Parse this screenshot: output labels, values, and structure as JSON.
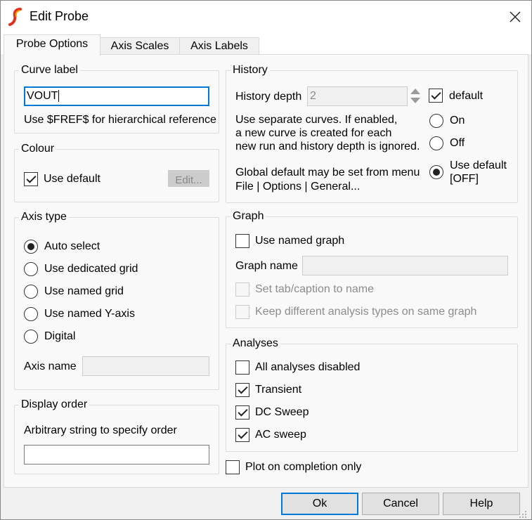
{
  "window": {
    "title": "Edit Probe",
    "close_icon": "close-icon",
    "app_icon": "simetrix-logo-icon"
  },
  "tabs": [
    {
      "label": "Probe Options",
      "active": true
    },
    {
      "label": "Axis Scales",
      "active": false
    },
    {
      "label": "Axis Labels",
      "active": false
    }
  ],
  "curve_label": {
    "group": "Curve label",
    "value": "VOUT",
    "hint": "Use $FREF$ for hierarchical reference"
  },
  "colour": {
    "group": "Colour",
    "use_default": "Use default",
    "use_default_checked": true,
    "edit_button": "Edit..."
  },
  "axis_type": {
    "group": "Axis type",
    "options": [
      {
        "label": "Auto select",
        "checked": true
      },
      {
        "label": "Use dedicated grid",
        "checked": false
      },
      {
        "label": "Use named grid",
        "checked": false
      },
      {
        "label": "Use named Y-axis",
        "checked": false
      },
      {
        "label": "Digital",
        "checked": false
      }
    ],
    "axis_name_label": "Axis name",
    "axis_name_value": ""
  },
  "display_order": {
    "group": "Display order",
    "hint": "Arbitrary string to specify order",
    "value": ""
  },
  "history": {
    "group": "History",
    "depth_label": "History depth",
    "depth_value": "2",
    "default_label": "default",
    "default_checked": true,
    "separate_text_1": "Use separate curves. If enabled,",
    "separate_text_2": "a new curve is created for each",
    "separate_text_3": "new run and history depth is ignored.",
    "global_text_1": "Global default may be set from menu",
    "global_text_2": "File | Options | General...",
    "radio_on": "On",
    "radio_off": "Off",
    "radio_default_1": "Use default",
    "radio_default_2": "[OFF]",
    "selected": "Use default"
  },
  "graph": {
    "group": "Graph",
    "use_named_graph": "Use named graph",
    "use_named_graph_checked": false,
    "graph_name_label": "Graph name",
    "graph_name_value": "",
    "set_tab": "Set tab/caption to name",
    "keep_different": "Keep different analysis types on same graph"
  },
  "analyses": {
    "group": "Analyses",
    "items": [
      {
        "label": "All analyses disabled",
        "checked": false
      },
      {
        "label": "Transient",
        "checked": true
      },
      {
        "label": "DC Sweep",
        "checked": true
      },
      {
        "label": "AC sweep",
        "checked": true
      }
    ]
  },
  "plot_on_completion": {
    "label": "Plot on completion only",
    "checked": false
  },
  "buttons": {
    "ok": "Ok",
    "cancel": "Cancel",
    "help": "Help"
  },
  "colors": {
    "focus_blue": "#0078d7",
    "logo_red": "#e0301e",
    "logo_orange": "#f5a000"
  }
}
